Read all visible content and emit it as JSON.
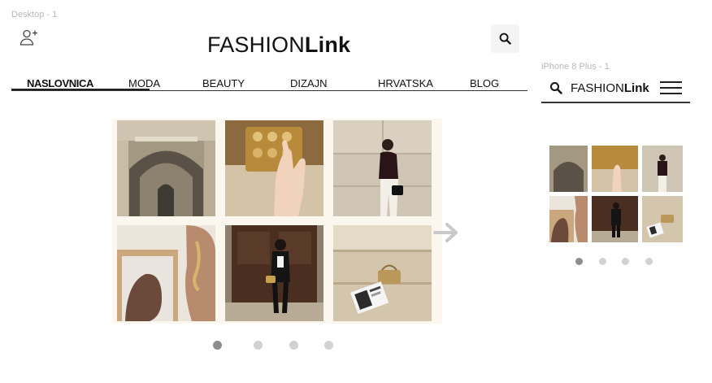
{
  "frames": {
    "desktop_label": "Desktop - 1",
    "mobile_label": "iPhone 8 Plus - 1"
  },
  "brand": {
    "part1": "FASHION",
    "part2": "Link"
  },
  "icons": {
    "add_user": "add-user-icon",
    "search": "search-icon",
    "next": "arrow-right-icon",
    "menu": "hamburger-menu-icon"
  },
  "nav": {
    "items": [
      {
        "label": "NASLOVNICA",
        "active": true
      },
      {
        "label": "MODA",
        "active": false
      },
      {
        "label": "BEAUTY",
        "active": false
      },
      {
        "label": "DIZAJN",
        "active": false
      },
      {
        "label": "HRVATSKA",
        "active": false
      },
      {
        "label": "BLOG",
        "active": false
      }
    ]
  },
  "gallery": {
    "photos": [
      "arched-passage",
      "hand-doorbells",
      "woman-wall",
      "earring-closeup",
      "woman-door",
      "bag-magazine-steps"
    ]
  },
  "carousel": {
    "desktop_pages": 4,
    "mobile_pages": 4,
    "active_index": 0
  },
  "colors": {
    "accent_dot": "#8d8d8d",
    "inactive_dot": "#d2d2d2",
    "search_bg": "#f4f4f4",
    "text": "#111111"
  }
}
